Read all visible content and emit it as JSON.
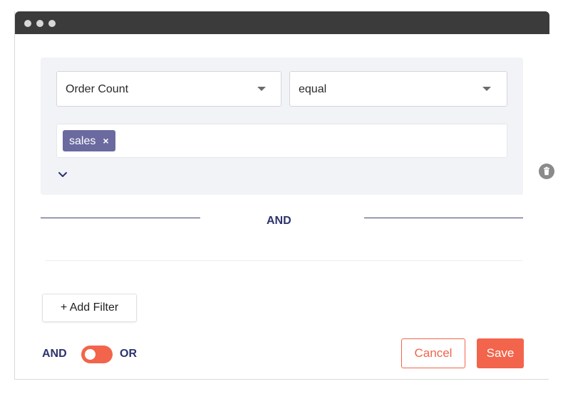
{
  "filter": {
    "field_select": {
      "value": "Order Count"
    },
    "operator_select": {
      "value": "equal"
    },
    "tags": [
      {
        "label": "sales",
        "remove_symbol": "×"
      }
    ]
  },
  "separator": {
    "label": "AND"
  },
  "actions": {
    "add_filter_label": "+ Add Filter",
    "logic_and_label": "AND",
    "logic_or_label": "OR",
    "cancel_label": "Cancel",
    "save_label": "Save"
  },
  "icons": {
    "select_caret": "caret-down-icon",
    "expand": "chevron-down-icon",
    "delete": "trash-icon",
    "tag_remove": "close-icon"
  },
  "colors": {
    "titlebar": "#3b3b3b",
    "accent": "#f2644b",
    "tag_bg": "#6a6aa0",
    "logic_text": "#2d336e",
    "panel_bg": "#f1f3f6"
  }
}
